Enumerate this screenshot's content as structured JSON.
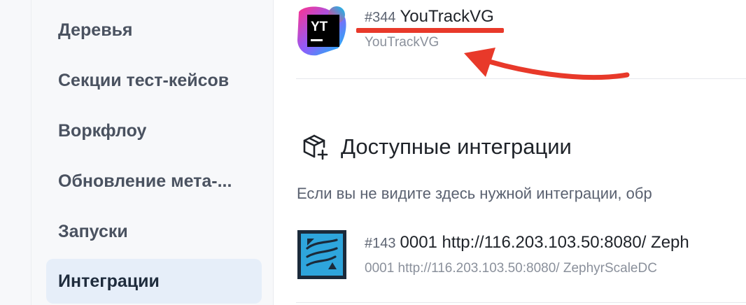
{
  "sidebar": {
    "items": [
      {
        "label": "Деревья",
        "active": false
      },
      {
        "label": "Секции тест-кейсов",
        "active": false
      },
      {
        "label": "Воркфлоу",
        "active": false
      },
      {
        "label": "Обновление мета-...",
        "active": false
      },
      {
        "label": "Запуски",
        "active": false
      },
      {
        "label": "Интеграции",
        "active": true
      }
    ]
  },
  "current_integration": {
    "id": "#344",
    "name": "YouTrackVG",
    "subtitle": "YouTrackVG",
    "icon": "youtrack-logo",
    "logo_text": "YT"
  },
  "available": {
    "title": "Доступные интеграции",
    "icon": "package-plus-icon",
    "hint": "Если вы не видите здесь нужной интеграции, обр",
    "items": [
      {
        "id": "#143",
        "name": "0001 http://116.203.103.50:8080/ Zeph",
        "subtitle": "0001 http://116.203.103.50:8080/ ZephyrScaleDC",
        "icon": "zephyr-scale-logo"
      }
    ]
  },
  "colors": {
    "annotation_red": "#e8392a",
    "sidebar_active_bg": "#e6eef9",
    "zephyr_blue": "#2ea5dc"
  }
}
